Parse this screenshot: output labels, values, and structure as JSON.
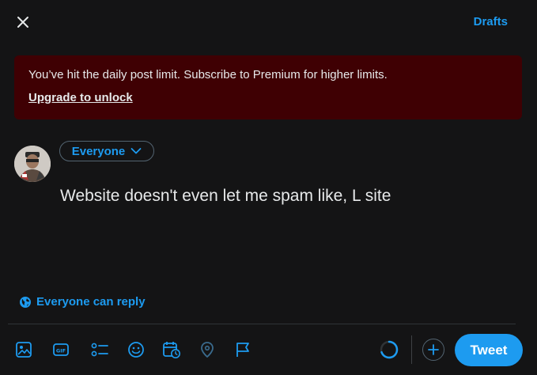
{
  "header": {
    "drafts_label": "Drafts",
    "close_icon": "close-icon"
  },
  "alert": {
    "message": "You’ve hit the daily post limit. Subscribe to Premium for higher limits.",
    "link_label": "Upgrade to unlock",
    "background": "#3f0003"
  },
  "composer": {
    "audience_label": "Everyone",
    "text": "Website doesn't even let me spam like, L site",
    "reply_setting_label": "Everyone can reply"
  },
  "toolbar": {
    "icons": [
      "image-icon",
      "gif-icon",
      "poll-icon",
      "emoji-icon",
      "schedule-icon",
      "location-icon",
      "flag-icon"
    ],
    "tweet_label": "Tweet"
  },
  "colors": {
    "accent": "#1d9bf0",
    "background": "#141415",
    "text": "#e7e9ea"
  }
}
